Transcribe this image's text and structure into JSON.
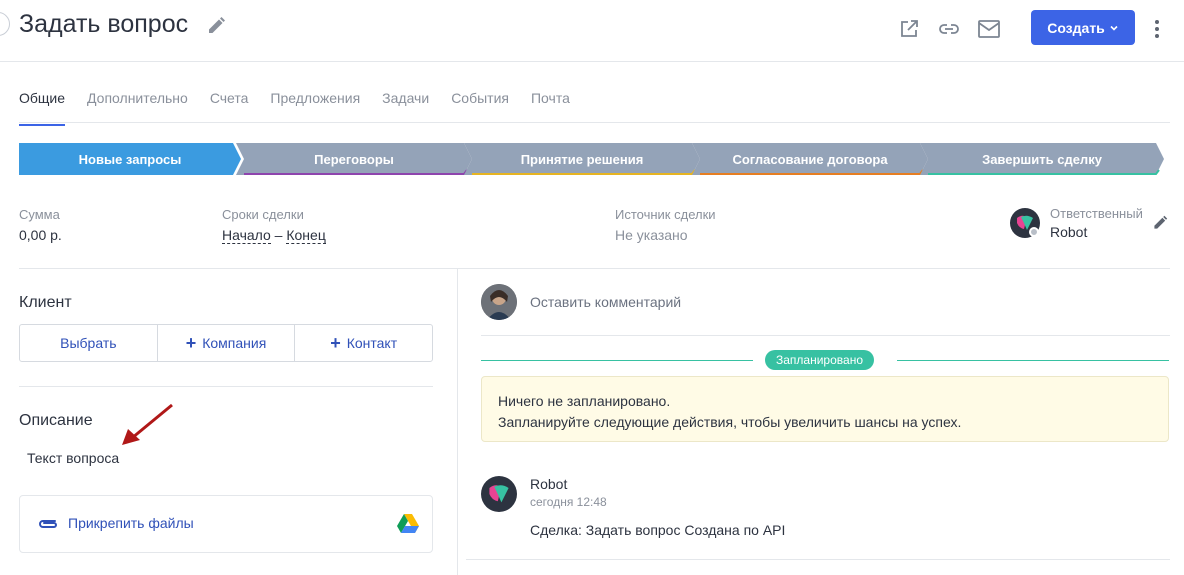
{
  "header": {
    "title": "Задать вопрос",
    "create_button": "Создать",
    "accent": "#3c64e6"
  },
  "tabs": [
    {
      "label": "Общие",
      "active": true
    },
    {
      "label": "Дополнительно"
    },
    {
      "label": "Счета"
    },
    {
      "label": "Предложения"
    },
    {
      "label": "Задачи"
    },
    {
      "label": "События"
    },
    {
      "label": "Почта"
    }
  ],
  "pipeline": [
    {
      "label": "Новые запросы",
      "color": "#3b9be0",
      "active": true
    },
    {
      "label": "Переговоры",
      "color": "#94a3b8",
      "underline": "#8e44ad"
    },
    {
      "label": "Принятие решения",
      "color": "#94a3b8",
      "underline": "#e6b422"
    },
    {
      "label": "Согласование договора",
      "color": "#94a3b8",
      "underline": "#e67e22"
    },
    {
      "label": "Завершить сделку",
      "color": "#94a3b8",
      "underline": "#37c1a2"
    }
  ],
  "info": {
    "sum_label": "Сумма",
    "sum_value": "0,00 р.",
    "terms_label": "Сроки сделки",
    "terms_start": "Начало",
    "terms_dash": "–",
    "terms_end": "Конец",
    "source_label": "Источник сделки",
    "source_value": "Не указано",
    "responsible_label": "Ответственный",
    "responsible_value": "Robot"
  },
  "client": {
    "title": "Клиент",
    "buttons": [
      "Выбрать",
      "Компания",
      "Контакт"
    ]
  },
  "description": {
    "title": "Описание",
    "text": "Текст вопроса"
  },
  "attach": {
    "label": "Прикрепить файлы"
  },
  "feed": {
    "comment_placeholder": "Оставить комментарий",
    "planned_badge": "Запланировано",
    "notice_line1": "Ничего не запланировано.",
    "notice_line2": "Запланируйте следующие действия, чтобы увеличить шансы на успех.",
    "entry": {
      "author": "Robot",
      "time": "сегодня 12:48",
      "message": "Сделка: Задать вопрос Создана по API"
    }
  }
}
